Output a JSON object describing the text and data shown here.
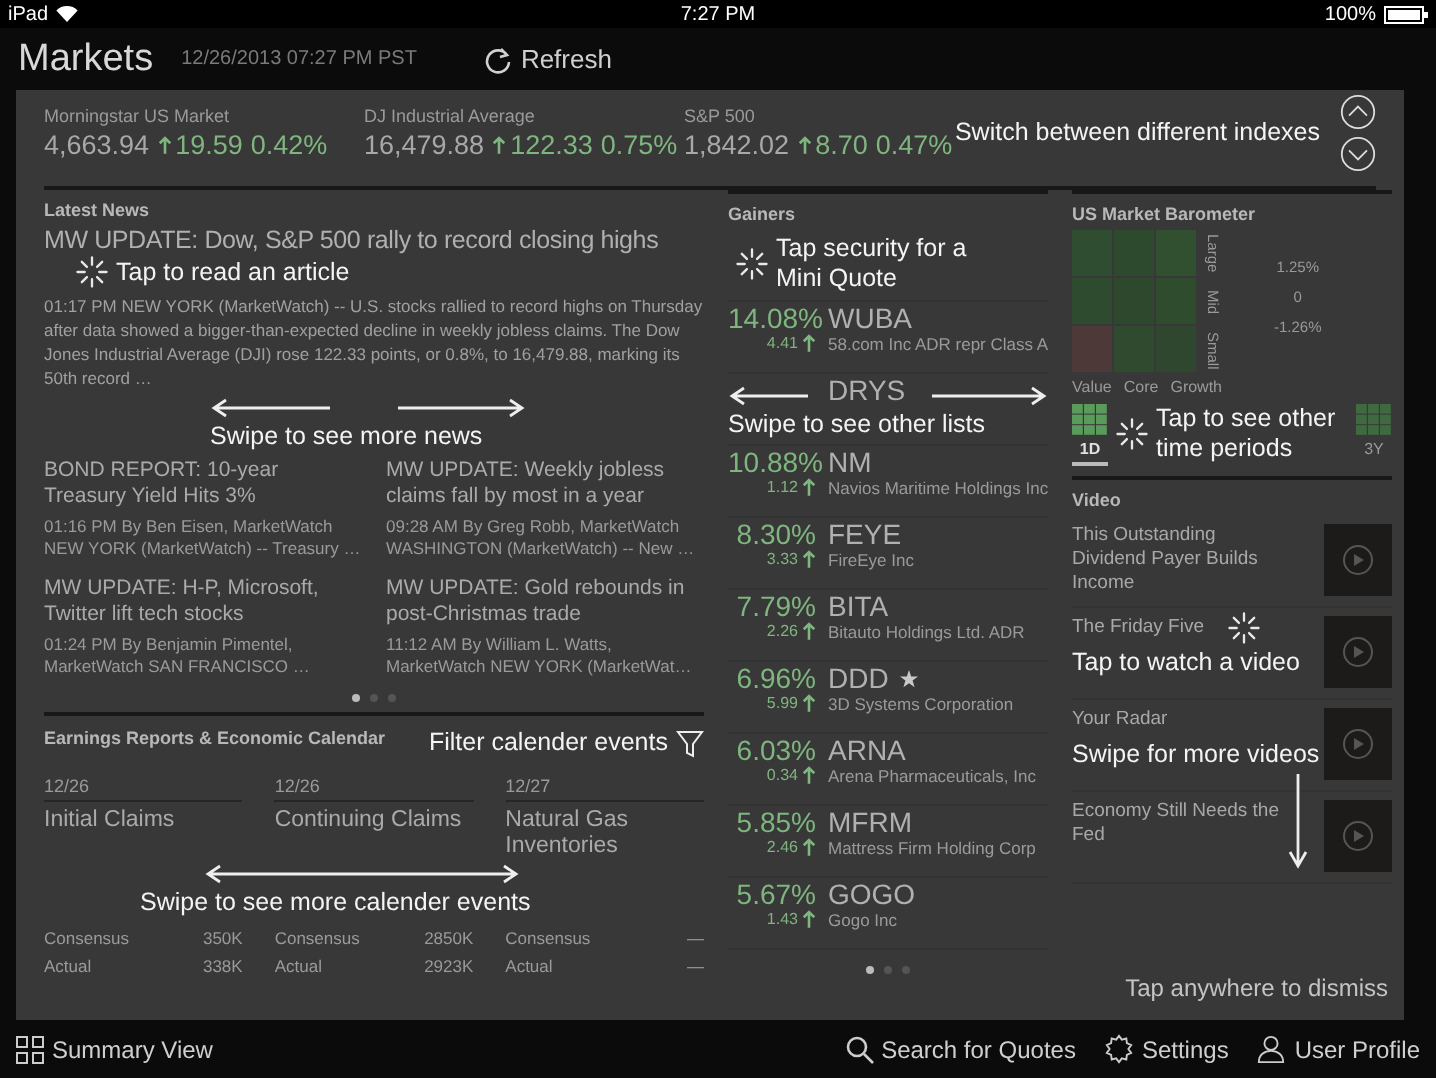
{
  "status_bar": {
    "device": "iPad",
    "time": "7:27 PM",
    "battery": "100%"
  },
  "header": {
    "title": "Markets",
    "timestamp": "12/26/2013 07:27 PM PST",
    "refresh": "Refresh"
  },
  "indexes": [
    {
      "name": "Morningstar US Market",
      "value": "4,663.94",
      "change": "19.59",
      "percent": "0.42%"
    },
    {
      "name": "DJ Industrial Average",
      "value": "16,479.88",
      "change": "122.33",
      "percent": "0.75%"
    },
    {
      "name": "S&P 500",
      "value": "1,842.02",
      "change": "8.70",
      "percent": "0.47%"
    }
  ],
  "news": {
    "title": "Latest News",
    "lead": {
      "headline": "MW UPDATE: Dow, S&P 500 rally to record closing highs",
      "body": "01:17 PM NEW YORK (MarketWatch) -- U.S. stocks rallied to record highs on Thursday after data showed a bigger-than-expected decline in weekly jobless claims. The Dow Jones Industrial Average (DJI) rose 122.33 points, or 0.8%, to 16,479.88, marking its 50th record …"
    },
    "articles": [
      {
        "headline": "BOND REPORT: 10-year Treasury Yield Hits 3%",
        "meta": "01:16 PM By Ben Eisen, MarketWatch",
        "snippet": "NEW YORK (MarketWatch) -- Treasury …"
      },
      {
        "headline": "MW UPDATE: Weekly jobless claims fall by most in a year",
        "meta": "09:28 AM By Greg Robb, MarketWatch",
        "snippet": "WASHINGTON (MarketWatch) -- New …"
      },
      {
        "headline": "MW UPDATE: H-P, Microsoft, Twitter lift tech stocks",
        "meta": "01:24 PM By Benjamin Pimentel,",
        "snippet": "MarketWatch    SAN FRANCISCO …"
      },
      {
        "headline": "MW UPDATE: Gold rebounds in post-Christmas trade",
        "meta": "11:12 AM By William L. Watts,",
        "snippet": "MarketWatch    NEW YORK (MarketWat…"
      }
    ],
    "pages": [
      {
        "selected": true
      },
      {
        "selected": false
      },
      {
        "selected": false
      }
    ]
  },
  "calendar": {
    "title": "Earnings Reports & Economic Calendar",
    "events": [
      {
        "date": "12/26",
        "name": "Initial Claims",
        "consensus_label": "Consensus",
        "consensus": "350K",
        "actual_label": "Actual",
        "actual": "338K"
      },
      {
        "date": "12/26",
        "name": "Continuing Claims",
        "consensus_label": "Consensus",
        "consensus": "2850K",
        "actual_label": "Actual",
        "actual": "2923K"
      },
      {
        "date": "12/27",
        "name": "Natural Gas Inventories",
        "consensus_label": "Consensus",
        "consensus": "—",
        "actual_label": "Actual",
        "actual": "—"
      }
    ]
  },
  "gainers": {
    "title": "Gainers",
    "rows": [
      {
        "starred": false
      },
      {
        "percent": "14.08%",
        "change": "4.41",
        "ticker": "WUBA",
        "name": "58.com Inc ADR repr Class A",
        "starred": false
      },
      {
        "ticker": "DRYS",
        "starred": false
      },
      {
        "percent": "10.88%",
        "change": "1.12",
        "ticker": "NM",
        "name": "Navios Maritime Holdings Inc",
        "starred": false
      },
      {
        "percent": "8.30%",
        "change": "3.33",
        "ticker": "FEYE",
        "name": "FireEye Inc",
        "starred": false
      },
      {
        "percent": "7.79%",
        "change": "2.26",
        "ticker": "BITA",
        "name": "Bitauto Holdings Ltd. ADR",
        "starred": false
      },
      {
        "percent": "6.96%",
        "change": "5.99",
        "ticker": "DDD",
        "name": "3D Systems Corporation",
        "starred": true
      },
      {
        "percent": "6.03%",
        "change": "0.34",
        "ticker": "ARNA",
        "name": "Arena Pharmaceuticals, Inc",
        "starred": false
      },
      {
        "percent": "5.85%",
        "change": "2.46",
        "ticker": "MFRM",
        "name": "Mattress Firm Holding Corp",
        "starred": false
      },
      {
        "percent": "5.67%",
        "change": "1.43",
        "ticker": "GOGO",
        "name": "Gogo Inc",
        "starred": false
      }
    ],
    "pages": [
      {
        "selected": true
      },
      {
        "selected": false
      },
      {
        "selected": false
      }
    ]
  },
  "barometer": {
    "title": "US Market Barometer",
    "rows": [
      "Large",
      "Mid",
      "Small"
    ],
    "columns": [
      "Value",
      "Core",
      "Growth"
    ],
    "cells": [
      {
        "color": "#2f4d30"
      },
      {
        "color": "#2e4a2e"
      },
      {
        "color": "#30502f"
      },
      {
        "color": "#2f4b2f"
      },
      {
        "color": "#2e482e"
      },
      {
        "color": "#2f4c2f"
      },
      {
        "color": "#4e3939"
      },
      {
        "color": "#2f4a2f"
      },
      {
        "color": "#2e472e"
      }
    ],
    "legend": [
      "1.25%",
      "0",
      "-1.26%"
    ],
    "periods": [
      {
        "label": "1D",
        "selected": true
      },
      {
        "label": "3Y",
        "selected": false
      }
    ]
  },
  "video": {
    "title": "Video",
    "items": [
      {
        "title": "This Outstanding Dividend Payer Builds Income"
      },
      {
        "title": "The Friday Five"
      },
      {
        "title": "Your Radar"
      },
      {
        "title": "Economy Still Needs the Fed"
      }
    ]
  },
  "coach_marks": [
    {
      "kind": "tap",
      "text": "Tap to read an article"
    },
    {
      "kind": "swipe",
      "text": "Swipe to see more news"
    },
    {
      "kind": "tap",
      "text": "Tap security for a Mini Quote"
    },
    {
      "kind": "swipe",
      "text": "Swipe to see other lists"
    },
    {
      "kind": "switch",
      "text": "Switch between different indexes"
    },
    {
      "kind": "tap",
      "text": "Tap to see other time periods"
    },
    {
      "kind": "tap-below",
      "text": "Tap to watch a video"
    },
    {
      "kind": "swipe-down",
      "text": "Swipe for more videos"
    },
    {
      "kind": "filter",
      "text": "Filter calender events"
    },
    {
      "kind": "swipe-both",
      "text": "Swipe to see more calender events"
    },
    {
      "kind": "plain",
      "text": "Tap anywhere to dismiss"
    }
  ],
  "bottom_bar": {
    "summary": "Summary View",
    "actions": [
      {
        "kind": "search",
        "label": "Search for Quotes"
      },
      {
        "kind": "settings",
        "label": "Settings"
      },
      {
        "kind": "profile",
        "label": "User Profile"
      }
    ]
  }
}
